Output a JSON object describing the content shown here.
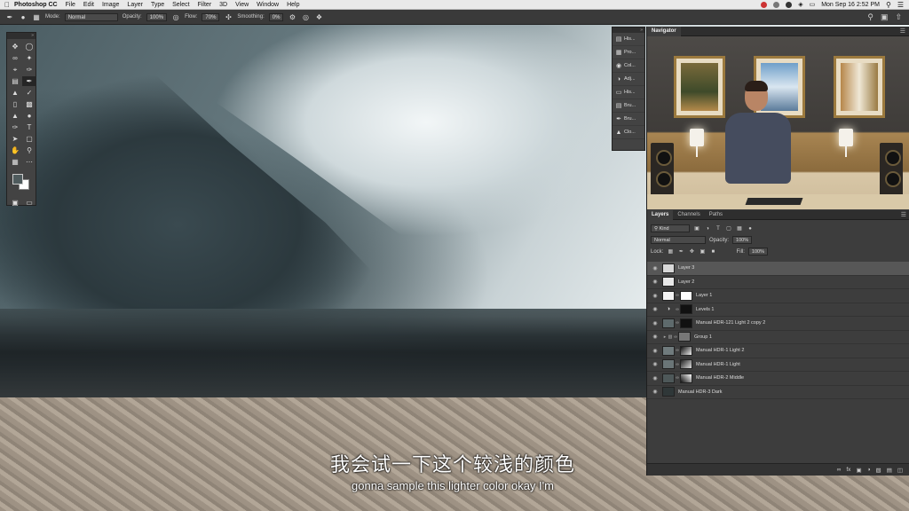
{
  "menubar": {
    "app_name": "Photoshop CC",
    "items": [
      "File",
      "Edit",
      "Image",
      "Layer",
      "Type",
      "Select",
      "Filter",
      "3D",
      "View",
      "Window",
      "Help"
    ],
    "clock": "Mon Sep 16  2:52 PM"
  },
  "options": {
    "mode_label": "Mode:",
    "mode_value": "Normal",
    "opacity_label": "Opacity:",
    "opacity_value": "100%",
    "flow_label": "Flow:",
    "flow_value": "70%",
    "smoothing_label": "Smoothing:",
    "smoothing_value": "0%"
  },
  "subtitles": {
    "chinese": "我会试一下这个较浅的颜色",
    "english": "gonna sample this lighter color okay I'm"
  },
  "dock": {
    "items": [
      {
        "label": "His...",
        "icon": "history-icon"
      },
      {
        "label": "Pro...",
        "icon": "properties-icon"
      },
      {
        "label": "Col...",
        "icon": "color-icon"
      },
      {
        "label": "Adj...",
        "icon": "adjustments-icon"
      },
      {
        "label": "His...",
        "icon": "histogram-icon"
      },
      {
        "label": "Bru...",
        "icon": "brush-settings-icon"
      },
      {
        "label": "Bru...",
        "icon": "brushes-icon"
      },
      {
        "label": "Clo...",
        "icon": "clone-source-icon"
      }
    ]
  },
  "navigator": {
    "tab_label": "Navigator"
  },
  "layers_panel": {
    "tabs": [
      "Layers",
      "Channels",
      "Paths"
    ],
    "filter_value": "Kind",
    "blend_mode": "Normal",
    "opacity_label": "Opacity:",
    "opacity_value": "100%",
    "lock_label": "Lock:",
    "fill_label": "Fill:",
    "fill_value": "100%",
    "layers": [
      {
        "name": "Layer 3",
        "selected": true,
        "thumb": "#d8d8d8"
      },
      {
        "name": "Layer 2",
        "selected": false,
        "thumb": "#e8e8e8"
      },
      {
        "name": "Layer 1",
        "selected": false,
        "thumb": "#f4f4f4"
      },
      {
        "name": "Levels 1",
        "selected": false,
        "thumb": "#111111"
      },
      {
        "name": "Manual HDR-121 Light 2 copy 2",
        "selected": false,
        "thumb": "#5e6a6c"
      },
      {
        "name": "Group 1",
        "selected": false,
        "thumb": "#777777"
      },
      {
        "name": "Manual HDR-1 Light 2",
        "selected": false,
        "thumb": "#707b7d"
      },
      {
        "name": "Manual HDR-1 Light",
        "selected": false,
        "thumb": "#6a7577"
      },
      {
        "name": "Manual HDR-2 Middle",
        "selected": false,
        "thumb": "#4e5859"
      },
      {
        "name": "Manual HDR-3 Dark",
        "selected": false,
        "thumb": "#2f3738"
      }
    ]
  }
}
